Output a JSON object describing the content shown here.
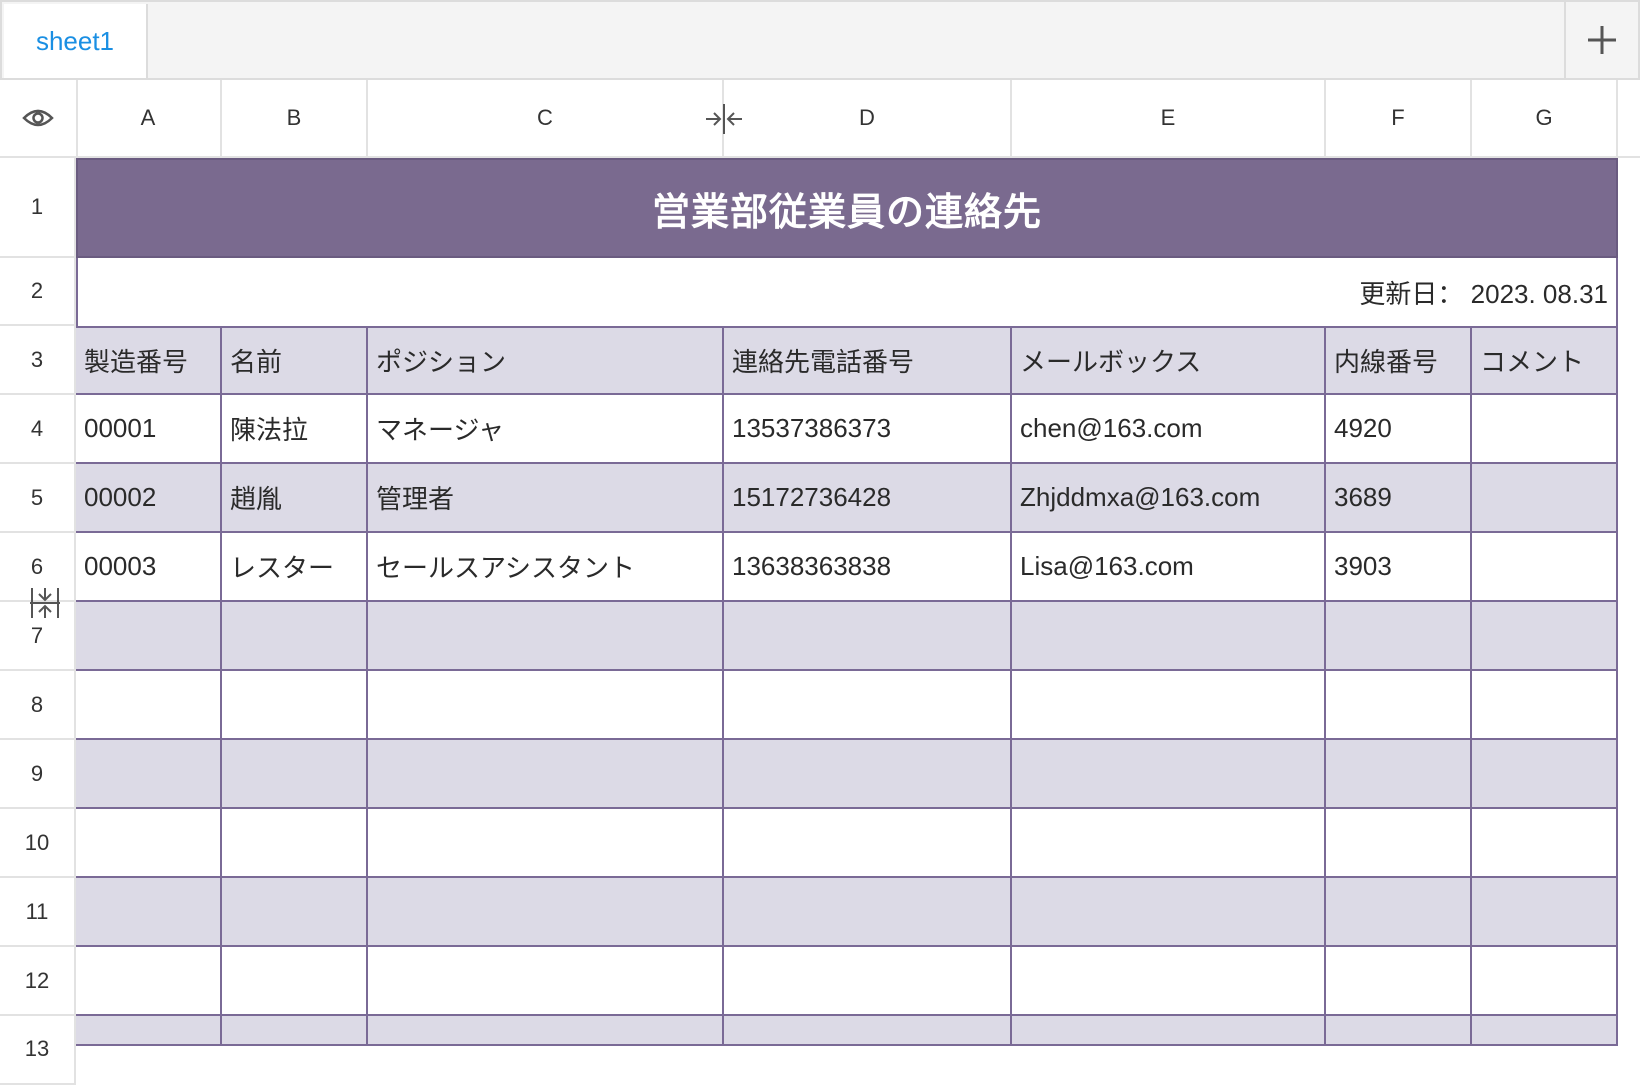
{
  "tabs": [
    {
      "label": "sheet1"
    }
  ],
  "columns": [
    "A",
    "B",
    "C",
    "D",
    "E",
    "F",
    "G"
  ],
  "rows": [
    "1",
    "2",
    "3",
    "4",
    "5",
    "6",
    "7",
    "8",
    "9",
    "10",
    "11",
    "12",
    "13"
  ],
  "sheet": {
    "title": "営業部従業員の連絡先",
    "updated": "更新日：  2023. 08.31",
    "headers": [
      "製造番号",
      "名前",
      "ポジション",
      "連絡先電話番号",
      "メールボックス",
      "内線番号",
      "コメント"
    ],
    "records": [
      [
        "00001",
        "陳法拉",
        "マネージャ",
        "13537386373",
        "chen@163.com",
        "4920",
        ""
      ],
      [
        "00002",
        "趙胤",
        "管理者",
        "15172736428",
        "Zhjddmxa@163.com",
        "3689",
        ""
      ],
      [
        "00003",
        "レスター",
        "セールスアシスタント",
        "13638363838",
        "Lisa@163.com",
        "3903",
        ""
      ]
    ]
  },
  "colors": {
    "title_bg": "#7a6a8f",
    "band": "#dcdae6",
    "grid_line": "#7a6a96",
    "tab_text": "#1a8fe3"
  },
  "icons": {
    "add_tab": "plus-icon",
    "visibility": "eye-icon",
    "column_resize": "column-resize-icon",
    "row_resize": "row-resize-icon"
  }
}
